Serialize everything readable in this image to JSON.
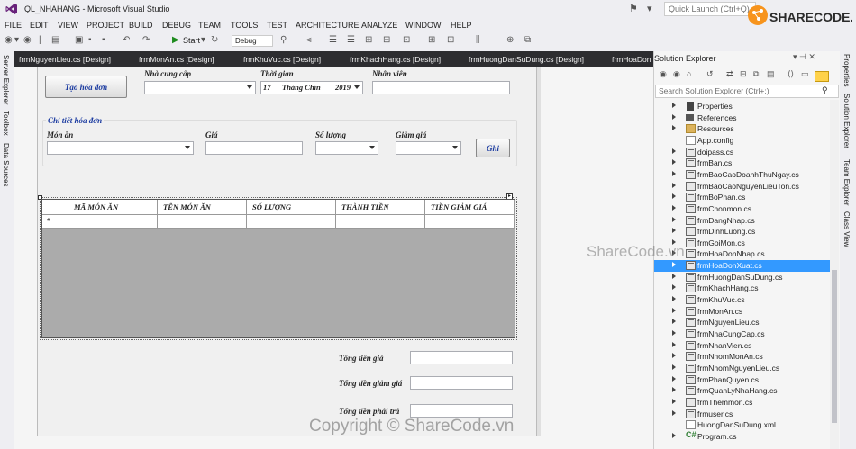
{
  "window": {
    "title": "QL_NHAHANG - Microsoft Visual Studio",
    "quick_launch_placeholder": "Quick Launch (Ctrl+Q)"
  },
  "menu": [
    "FILE",
    "EDIT",
    "VIEW",
    "PROJECT",
    "BUILD",
    "DEBUG",
    "TEAM",
    "TOOLS",
    "TEST",
    "ARCHITECTURE",
    "ANALYZE",
    "WINDOW",
    "HELP"
  ],
  "toolbar": {
    "start_label": "Start",
    "config": "Debug"
  },
  "left_tabs": [
    "Server Explorer",
    "Toolbox",
    "Data Sources"
  ],
  "doc_tabs": [
    "frmNguyenLieu.cs [Design]",
    "frmMonAn.cs [Design]",
    "frmKhuVuc.cs [Design]",
    "frmKhachHang.cs [Design]",
    "frmHuongDanSuDung.cs [Design]",
    "frmHoaDon"
  ],
  "form": {
    "create_button": "Tạo hóa đơn",
    "supplier_label": "Nhà cung cấp",
    "time_label": "Thời gian",
    "staff_label": "Nhân viên",
    "date": {
      "day": "17",
      "month": "Tháng Chín",
      "year": "2019"
    },
    "group_title": "Chi tiết hóa đơn",
    "dish_label": "Món ăn",
    "price_label": "Giá",
    "qty_label": "Số lượng",
    "discount_label": "Giảm giá",
    "save_button": "Ghi",
    "grid_columns": [
      "MÃ MÓN ĂN",
      "TÊN MÓN ĂN",
      "SỐ LƯỢNG",
      "THÀNH TIỀN",
      "TIỀN GIẢM GIÁ"
    ],
    "new_row_marker": "*",
    "total_label": "Tổng tiền giá",
    "total_discount_label": "Tổng tiền giảm giá",
    "total_pay_label": "Tổng tiền phải trả"
  },
  "solution_explorer": {
    "title": "Solution Explorer",
    "search_placeholder": "Search Solution Explorer (Ctrl+;)",
    "items": [
      {
        "name": "Properties",
        "icon": "properties-icon",
        "expandable": true
      },
      {
        "name": "References",
        "icon": "references-icon",
        "expandable": true
      },
      {
        "name": "Resources",
        "icon": "folder-icon",
        "expandable": true
      },
      {
        "name": "App.config",
        "icon": "config-file-icon",
        "expandable": false
      },
      {
        "name": "doipass.cs",
        "icon": "form-icon",
        "expandable": true
      },
      {
        "name": "frmBan.cs",
        "icon": "form-icon",
        "expandable": true
      },
      {
        "name": "frmBaoCaoDoanhThuNgay.cs",
        "icon": "form-icon",
        "expandable": true
      },
      {
        "name": "frmBaoCaoNguyenLieuTon.cs",
        "icon": "form-icon",
        "expandable": true
      },
      {
        "name": "frmBoPhan.cs",
        "icon": "form-icon",
        "expandable": true
      },
      {
        "name": "frmChonmon.cs",
        "icon": "form-icon",
        "expandable": true
      },
      {
        "name": "frmDangNhap.cs",
        "icon": "form-icon",
        "expandable": true
      },
      {
        "name": "frmDinhLuong.cs",
        "icon": "form-icon",
        "expandable": true
      },
      {
        "name": "frmGoiMon.cs",
        "icon": "form-icon",
        "expandable": true
      },
      {
        "name": "frmHoaDonNhap.cs",
        "icon": "form-icon",
        "expandable": true
      },
      {
        "name": "frmHoaDonXuat.cs",
        "icon": "form-icon",
        "expandable": true,
        "selected": true
      },
      {
        "name": "frmHuongDanSuDung.cs",
        "icon": "form-icon",
        "expandable": true
      },
      {
        "name": "frmKhachHang.cs",
        "icon": "form-icon",
        "expandable": true
      },
      {
        "name": "frmKhuVuc.cs",
        "icon": "form-icon",
        "expandable": true
      },
      {
        "name": "frmMonAn.cs",
        "icon": "form-icon",
        "expandable": true
      },
      {
        "name": "frmNguyenLieu.cs",
        "icon": "form-icon",
        "expandable": true
      },
      {
        "name": "frmNhaCungCap.cs",
        "icon": "form-icon",
        "expandable": true
      },
      {
        "name": "frmNhanVien.cs",
        "icon": "form-icon",
        "expandable": true
      },
      {
        "name": "frmNhomMonAn.cs",
        "icon": "form-icon",
        "expandable": true
      },
      {
        "name": "frmNhomNguyenLieu.cs",
        "icon": "form-icon",
        "expandable": true
      },
      {
        "name": "frmPhanQuyen.cs",
        "icon": "form-icon",
        "expandable": true
      },
      {
        "name": "frmQuanLyNhaHang.cs",
        "icon": "form-icon",
        "expandable": true
      },
      {
        "name": "frmThemmon.cs",
        "icon": "form-icon",
        "expandable": true
      },
      {
        "name": "frmuser.cs",
        "icon": "form-icon",
        "expandable": true
      },
      {
        "name": "HuongDanSuDung.xml",
        "icon": "xml-file-icon",
        "expandable": false
      },
      {
        "name": "Program.cs",
        "icon": "csharp-file-icon",
        "expandable": true
      }
    ]
  },
  "right_tabs": [
    "Properties",
    "Solution Explorer",
    "Team Explorer",
    "Class View"
  ],
  "watermarks": {
    "logo": "SHARECODE.vn",
    "center": "ShareCode.vn",
    "bottom": "Copyright © ShareCode.vn"
  },
  "colors": {
    "accent": "#3399ff",
    "tab_bar": "#2d2d30",
    "vs_purple": "#68217a",
    "logo_orange": "#f7941d"
  }
}
